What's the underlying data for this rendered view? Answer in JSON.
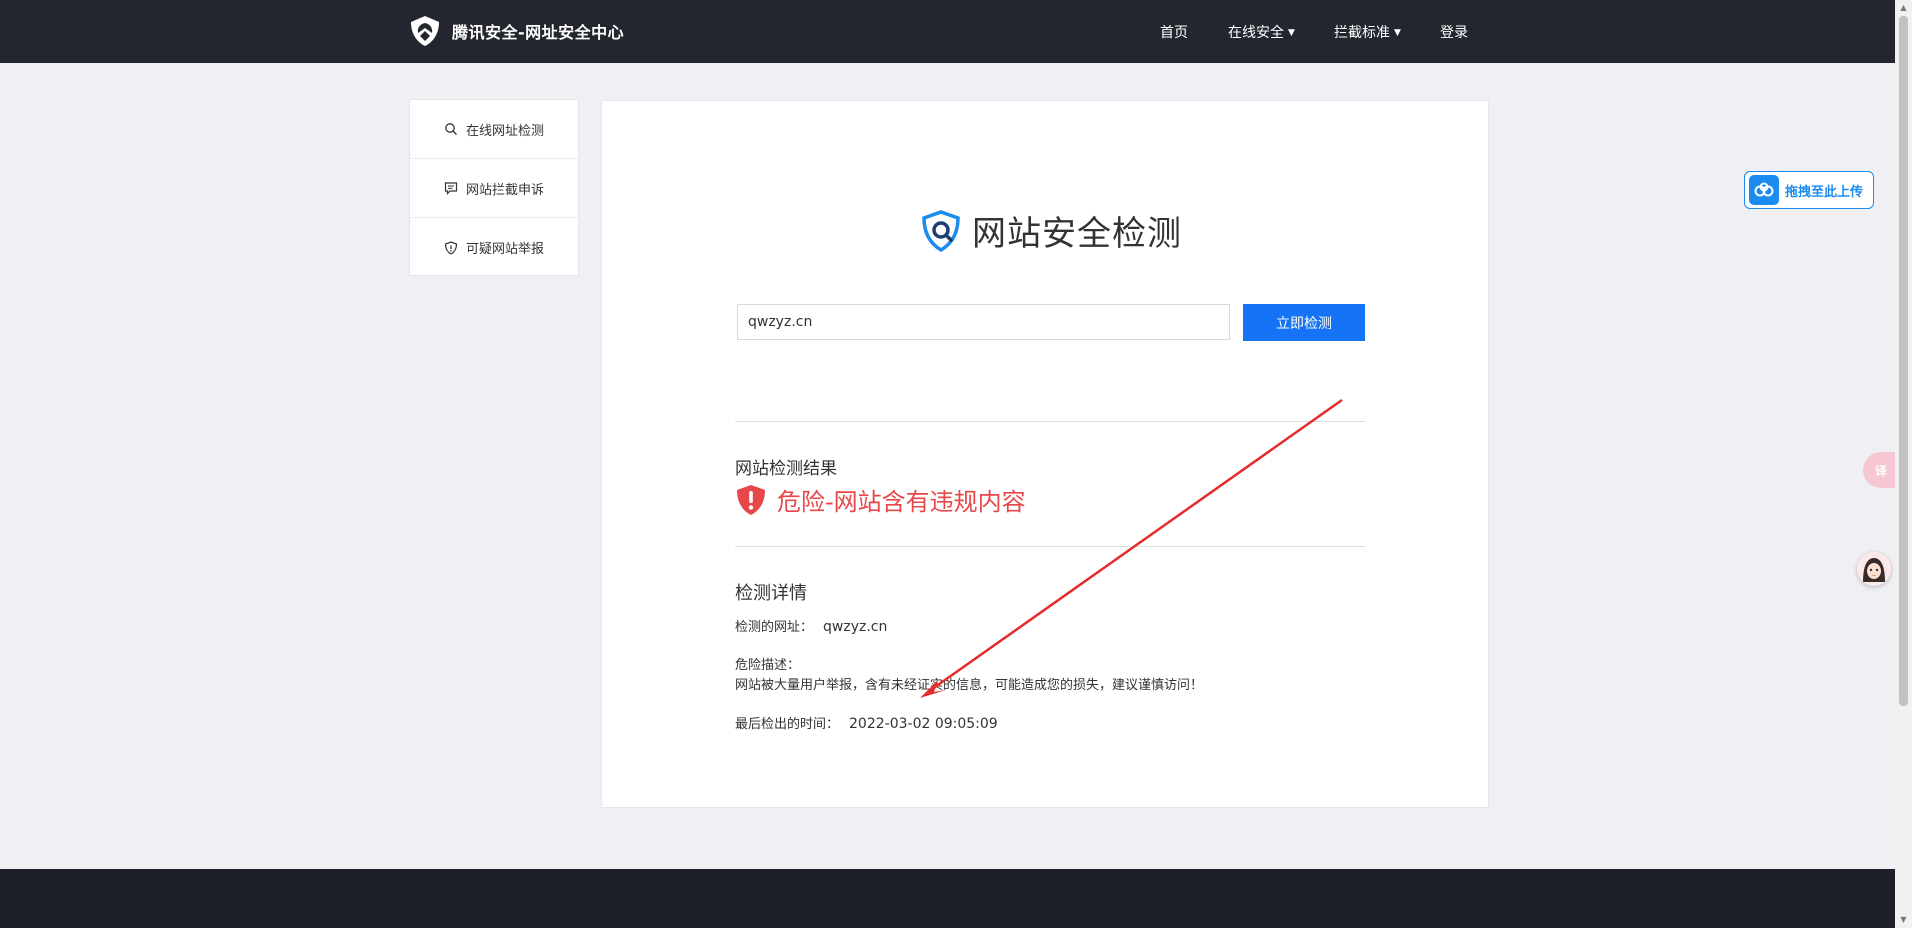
{
  "header": {
    "brand": "腾讯安全-网址安全中心",
    "nav": [
      {
        "label": "首页",
        "dropdown": false
      },
      {
        "label": "在线安全",
        "dropdown": true
      },
      {
        "label": "拦截标准",
        "dropdown": true
      },
      {
        "label": "登录",
        "dropdown": false
      }
    ]
  },
  "sidebar": {
    "items": [
      {
        "label": "在线网址检测",
        "icon": "search-icon"
      },
      {
        "label": "网站拦截申诉",
        "icon": "chat-icon"
      },
      {
        "label": "可疑网站举报",
        "icon": "shield-icon"
      }
    ]
  },
  "main": {
    "title": "网站安全检测",
    "search": {
      "value": "qwzyz.cn",
      "button": "立即检测"
    },
    "result": {
      "label": "网站检测结果",
      "status": "危险-网站含有违规内容",
      "status_color": "#e8474a"
    },
    "details": {
      "title": "检测详情",
      "url_label": "检测的网址：",
      "url_value": "qwzyz.cn",
      "risk_label": "危险描述：",
      "risk_text": "网站被大量用户举报，含有未经证实的信息，可能造成您的损失，建议谨慎访问！",
      "time_label": "最后检出的时间：",
      "time_value": "2022-03-02 09:05:09"
    }
  },
  "widgets": {
    "upload_label": "拖拽至此上传",
    "translate_label": "译"
  },
  "colors": {
    "accent": "#1474f5",
    "topbar": "#23262f",
    "danger": "#e8474a"
  }
}
